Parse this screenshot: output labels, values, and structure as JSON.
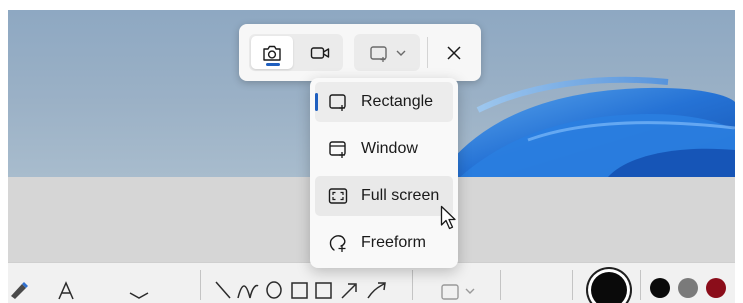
{
  "snipping_bar": {
    "modes": [
      {
        "name": "camera-icon",
        "active": true
      },
      {
        "name": "video-camera-icon",
        "active": false
      }
    ],
    "shape_dropdown_icon": "rectangle-snip-icon",
    "shape_dropdown_chevron": "chevron-down-icon",
    "close_icon": "close-icon"
  },
  "snip_mode_menu": {
    "items": [
      {
        "label": "Rectangle",
        "icon": "rectangle-snip-icon",
        "selected": true
      },
      {
        "label": "Window",
        "icon": "window-snip-icon",
        "selected": false
      },
      {
        "label": "Full screen",
        "icon": "full-screen-snip-icon",
        "selected": false,
        "hovered": true
      },
      {
        "label": "Freeform",
        "icon": "freeform-snip-icon",
        "selected": false
      }
    ]
  },
  "paint_toolbar": {
    "swatch_colors": [
      "#0a0a0a",
      "#0a0a0a",
      "#7a7a7a",
      "#8b0d1a"
    ]
  },
  "colors": {
    "accent": "#1f5fbf",
    "wallpaper": "#9bb1c6",
    "bloom_blue": "#1f6fd6"
  }
}
